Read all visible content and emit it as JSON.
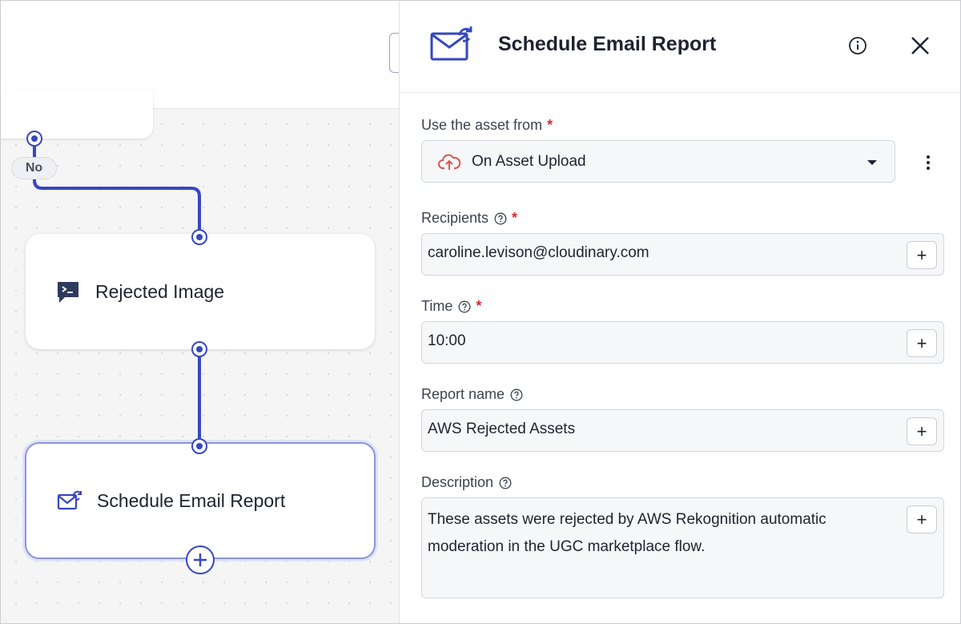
{
  "canvas": {
    "branch_label": "No",
    "nodes": [
      {
        "label": "Rejected Image",
        "icon": "terminal-icon"
      },
      {
        "label": "Schedule Email Report",
        "icon": "email-schedule-icon"
      }
    ]
  },
  "panel": {
    "title": "Schedule Email Report",
    "icon": "email-schedule-icon",
    "fields": {
      "asset_source": {
        "label": "Use the asset from",
        "required_mark": "*",
        "value": "On Asset Upload",
        "icon": "cloud-upload-icon"
      },
      "recipients": {
        "label": "Recipients",
        "required_mark": "*",
        "value": "caroline.levison@cloudinary.com"
      },
      "time": {
        "label": "Time",
        "required_mark": "*",
        "value": "10:00"
      },
      "report_name": {
        "label": "Report name",
        "value": "AWS Rejected Assets"
      },
      "description": {
        "label": "Description",
        "value": "These assets were rejected by AWS Rekognition automatic moderation in the UGC marketplace flow."
      }
    },
    "add_button_label": "+"
  },
  "colors": {
    "accent": "#3647c2",
    "required": "#d62d2d",
    "cloud_icon": "#e0534f"
  }
}
